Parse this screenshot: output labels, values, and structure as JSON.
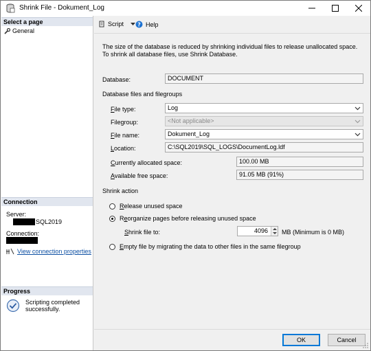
{
  "window": {
    "title": "Shrink File - Dokument_Log"
  },
  "sidebar": {
    "select_page_header": "Select a page",
    "general_label": "General",
    "connection_header": "Connection",
    "server_label": "Server:",
    "server_value_suffix": "SQL2019",
    "connection_label": "Connection:",
    "view_connection_properties": "View connection properties",
    "progress_header": "Progress",
    "progress_status": "Scripting completed successfully."
  },
  "toolbar": {
    "script_label": "Script",
    "help_label": "Help"
  },
  "main": {
    "description": "The size of the database is reduced by shrinking individual files to release unallocated space. To shrink all database files, use Shrink Database.",
    "database_label": "Database:",
    "database_value": "DOCUMENT",
    "files_group_label": "Database files and filegroups",
    "file_type_label": "File type:",
    "file_type_value": "Log",
    "filegroup_label": "Filegroup:",
    "filegroup_value": "<Not applicable>",
    "file_name_label": "File name:",
    "file_name_value": "Dokument_Log",
    "location_label": "Location:",
    "location_value": "C:\\SQL2019\\SQL_LOGS\\DocumentLog.ldf",
    "allocated_label": "Currently allocated space:",
    "allocated_value": "100.00 MB",
    "free_label": "Available free space:",
    "free_value": "91.05 MB (91%)",
    "shrink_action_label": "Shrink action",
    "radio_release": "Release unused space",
    "radio_reorganize": "Reorganize pages before releasing unused space",
    "shrink_file_to_label": "Shrink file to:",
    "shrink_file_to_value": "4096",
    "shrink_unit_note": "MB (Minimum is 0 MB)",
    "radio_empty": "Empty file by migrating the data to other files in the same filegroup",
    "selected_action": "reorganize"
  },
  "footer": {
    "ok_label": "OK",
    "cancel_label": "Cancel"
  },
  "colors": {
    "section_header_bg": "#e1e6ef",
    "link": "#0b4ea2",
    "accent": "#0078d7"
  }
}
